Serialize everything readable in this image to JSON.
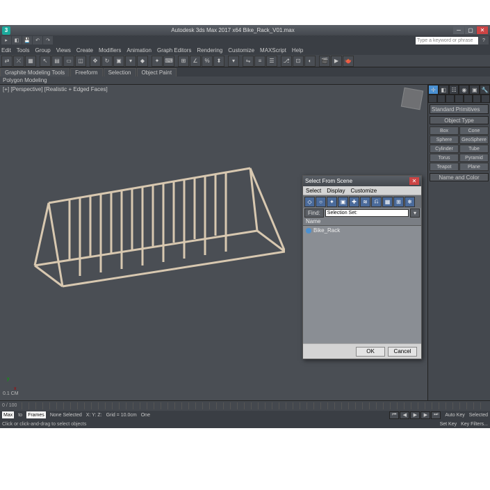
{
  "titlebar": {
    "app_initial": "3",
    "title": "Autodesk 3ds Max 2017 x64   Bike_Rack_V01.max"
  },
  "menubar": {
    "items": [
      "Edit",
      "Tools",
      "Group",
      "Views",
      "Create",
      "Modifiers",
      "Animation",
      "Graph Editors",
      "Rendering",
      "Customize",
      "MAXScript",
      "Help"
    ]
  },
  "search": {
    "placeholder": "Type a keyword or phrase"
  },
  "ribbon": {
    "tabs": [
      "Graphite Modeling Tools",
      "Freeform",
      "Selection",
      "Object Paint"
    ],
    "sub_mode": "Polygon Modeling"
  },
  "viewport": {
    "label": "[+] [Perspective] [Realistic + Edged Faces]",
    "grid_value": "0.1 CM"
  },
  "command_panel": {
    "dropdown": "Standard Primitives",
    "rollout": "Object Type",
    "buttons": [
      "Box",
      "Cone",
      "Sphere",
      "GeoSphere",
      "Cylinder",
      "Tube",
      "Torus",
      "Pyramid",
      "Teapot",
      "Plane"
    ],
    "rollout2": "Name and Color"
  },
  "dialog": {
    "title": "Select From Scene",
    "menus": [
      "Select",
      "Display",
      "Customize"
    ],
    "filter_find": "Find:",
    "filter_sel": "Selection Set:",
    "col_name": "Name",
    "items": [
      {
        "name": "Bike_Rack"
      }
    ],
    "ok": "OK",
    "cancel": "Cancel"
  },
  "status": {
    "none_selected": "None Selected",
    "prompt": "Click or click-and-drag to select objects",
    "frame": "0 / 100",
    "coords": "X:         Y:         Z:",
    "grid": "Grid = 10.0cm",
    "one": "One",
    "autokey": "Auto Key",
    "setkey": "Set Key",
    "selected": "Selected",
    "keyfilters": "Key Filters..."
  },
  "slider": {
    "max_label": "Max",
    "to": "to",
    "frames": "Frames"
  }
}
